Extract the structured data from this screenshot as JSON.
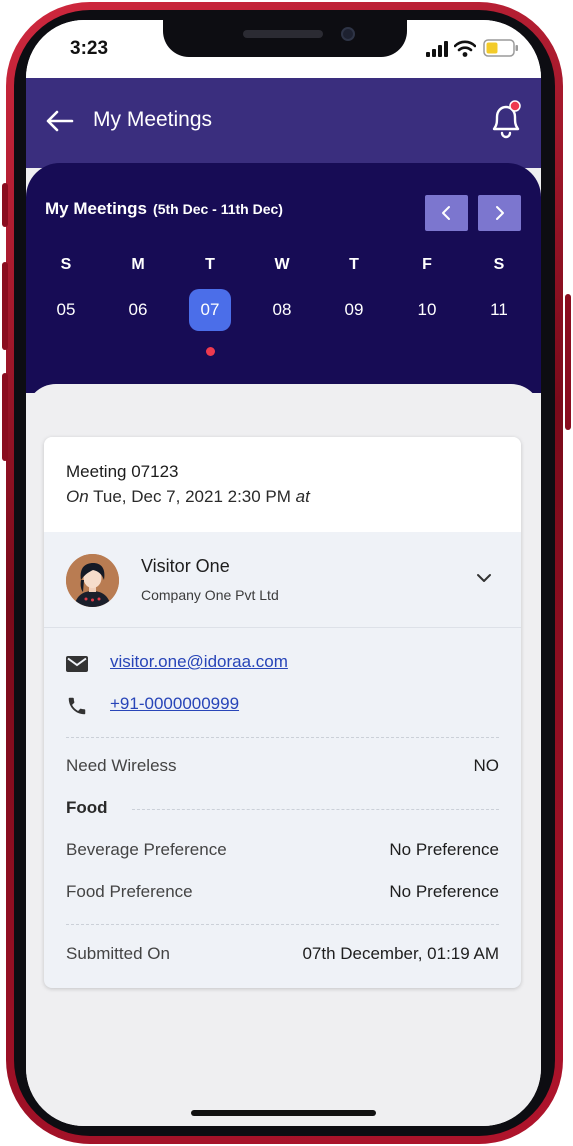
{
  "status_bar": {
    "time": "3:23"
  },
  "header": {
    "title": "My Meetings"
  },
  "calendar": {
    "title": "My Meetings",
    "range": "(5th Dec - 11th Dec)",
    "days": [
      {
        "name": "S",
        "num": "05"
      },
      {
        "name": "M",
        "num": "06"
      },
      {
        "name": "T",
        "num": "07"
      },
      {
        "name": "W",
        "num": "08"
      },
      {
        "name": "T",
        "num": "09"
      },
      {
        "name": "F",
        "num": "10"
      },
      {
        "name": "S",
        "num": "11"
      }
    ],
    "selected_index": 2,
    "event_dot_index": 2
  },
  "meeting": {
    "title": "Meeting 07123",
    "on_label": "On",
    "datetime": "Tue, Dec 7, 2021 2:30 PM",
    "at_label": "at"
  },
  "visitor": {
    "name": "Visitor One",
    "company": "Company One Pvt Ltd",
    "email": "visitor.one@idoraa.com",
    "phone": "+91-0000000999"
  },
  "details": {
    "need_wireless_label": "Need Wireless",
    "need_wireless_value": "NO",
    "food_section": "Food",
    "beverage_label": "Beverage Preference",
    "beverage_value": "No Preference",
    "food_pref_label": "Food Preference",
    "food_pref_value": "No Preference",
    "submitted_label": "Submitted On",
    "submitted_value": "07th December, 01:19 AM"
  },
  "colors": {
    "app_bar": "#3a2e7e",
    "calendar_bg": "#170c55",
    "selected_day": "#4b6ee9",
    "nav_button": "#7c76cf",
    "event_dot": "#ee3a4f",
    "link": "#2845b8"
  },
  "icons": [
    "back-arrow-icon",
    "bell-icon",
    "chevron-left-icon",
    "chevron-right-icon",
    "chevron-down-icon",
    "mail-icon",
    "phone-icon",
    "signal-icon",
    "wifi-icon",
    "battery-icon"
  ]
}
